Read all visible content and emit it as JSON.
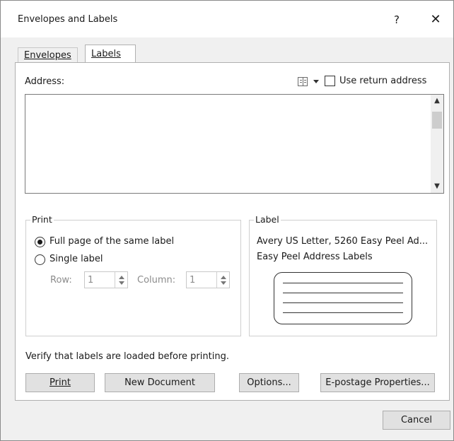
{
  "window": {
    "title": "Envelopes and Labels",
    "help": "?",
    "close": "✕"
  },
  "tabs": [
    {
      "label": "Envelopes",
      "selected": false
    },
    {
      "label": "Labels",
      "selected": true
    }
  ],
  "address": {
    "label": "Address:",
    "value": "",
    "address_book_icon": "address-book-icon",
    "use_return_address": {
      "label": "Use return address",
      "checked": false
    }
  },
  "print_group": {
    "title": "Print",
    "full_page_label": "Full page of the same label",
    "single_label_label": "Single label",
    "selected": "full_page",
    "row": {
      "label": "Row:",
      "value": "1"
    },
    "column": {
      "label": "Column:",
      "value": "1"
    }
  },
  "label_group": {
    "title": "Label",
    "line1": "Avery US Letter, 5260 Easy Peel Ad...",
    "line2": "Easy Peel Address Labels"
  },
  "verify_text": "Verify that labels are loaded before printing.",
  "buttons": {
    "print": "Print",
    "new_document": "New Document",
    "options": "Options...",
    "epostage": "E-postage Properties...",
    "cancel": "Cancel"
  },
  "colors": {
    "dialog_bg": "#f0f0f0",
    "panel_bg": "#ffffff",
    "button_bg": "#e1e1e1"
  }
}
